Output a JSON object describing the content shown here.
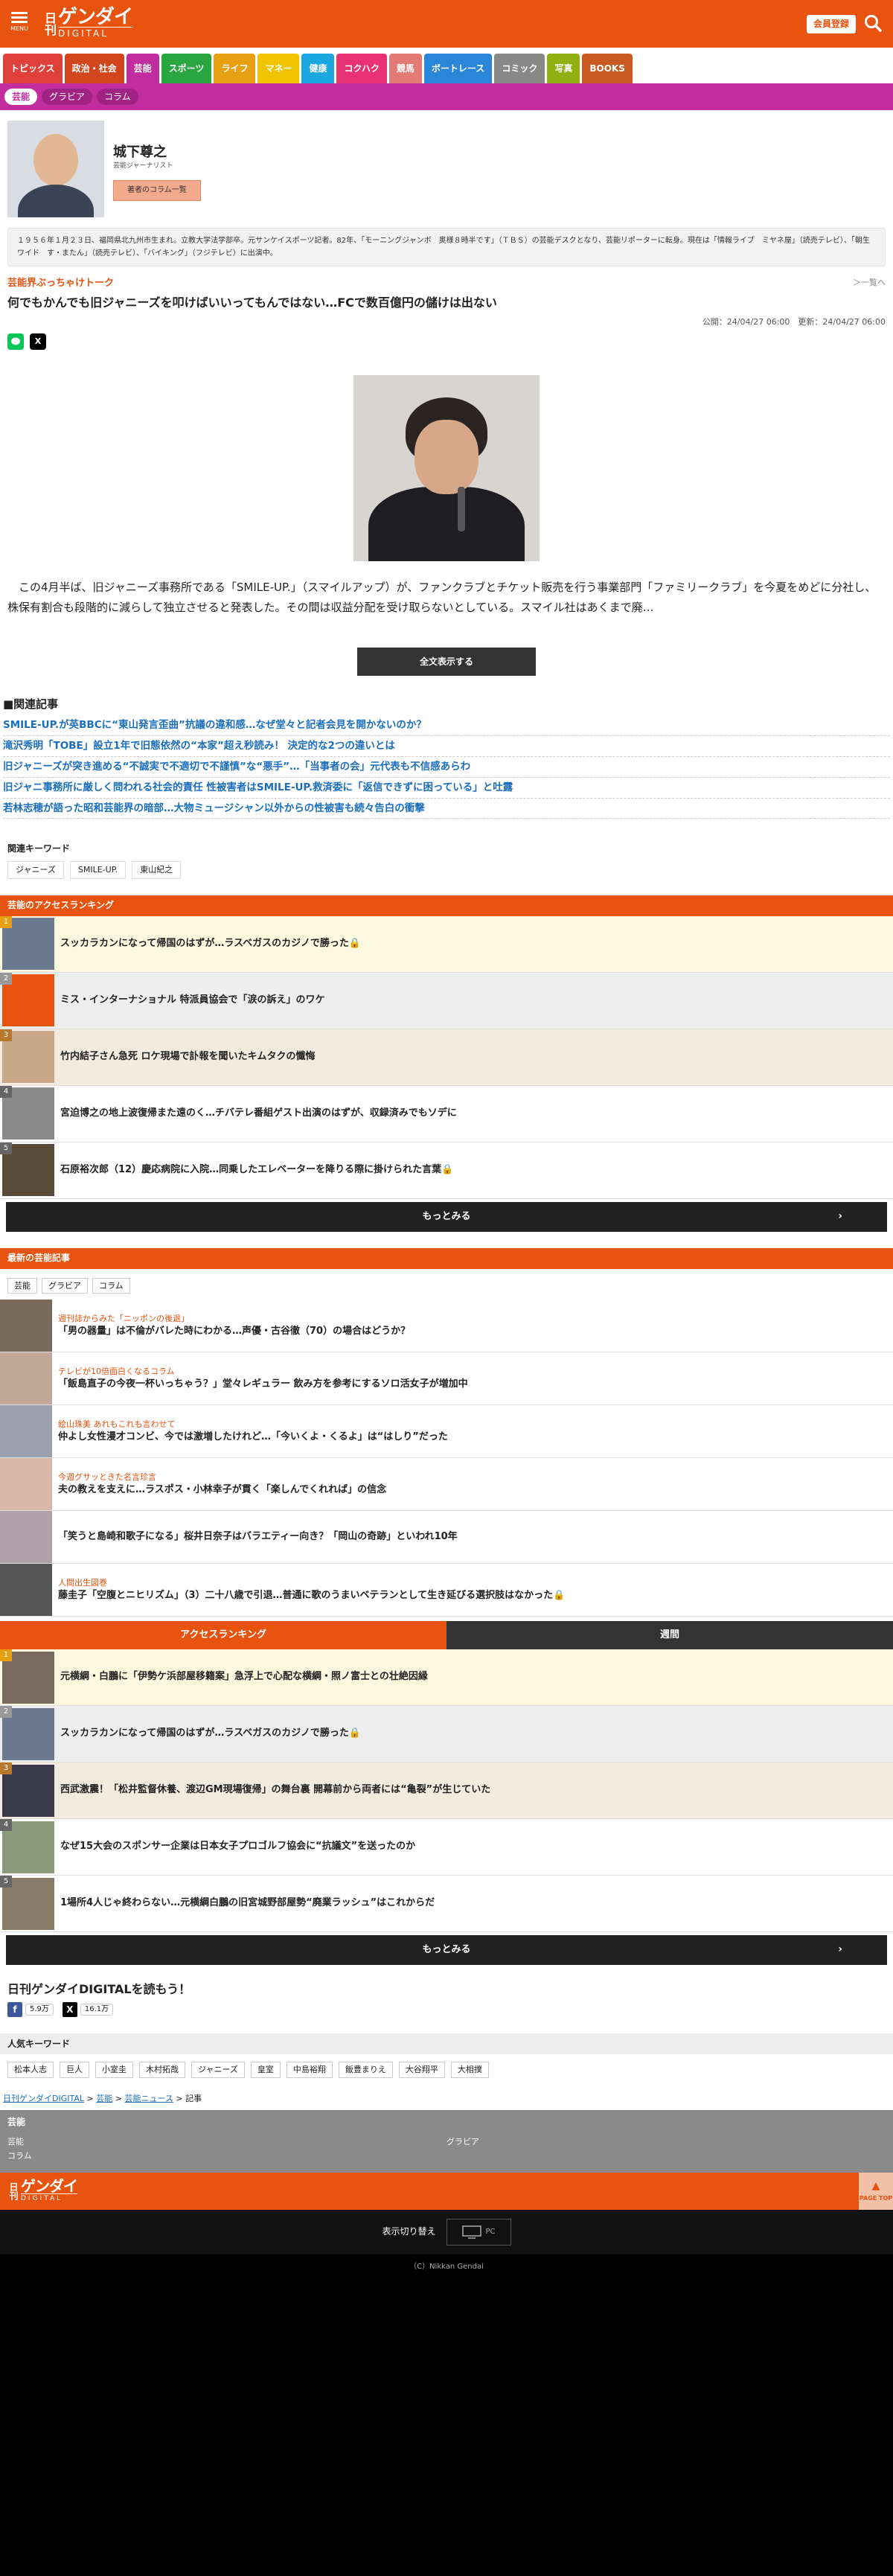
{
  "header": {
    "menu_label": "MENU",
    "logo_nikkan": "日刊",
    "logo_gendai": "ゲンダイ",
    "logo_digital": "DIGITAL",
    "member_label": "会員登録",
    "accent": "#e8530f"
  },
  "categories": [
    {
      "label": "トピックス",
      "color": "#e0403a"
    },
    {
      "label": "政治・社会",
      "color": "#d2461e"
    },
    {
      "label": "芸能",
      "color": "#c12d9e"
    },
    {
      "label": "スポーツ",
      "color": "#2aa640"
    },
    {
      "label": "ライフ",
      "color": "#e8a012"
    },
    {
      "label": "マネー",
      "color": "#f0c400"
    },
    {
      "label": "健康",
      "color": "#1ba8e0"
    },
    {
      "label": "コクハク",
      "color": "#e83272"
    },
    {
      "label": "競馬",
      "color": "#e37b74"
    },
    {
      "label": "ボートレース",
      "color": "#2a86d8"
    },
    {
      "label": "コミック",
      "color": "#888888"
    },
    {
      "label": "写真",
      "color": "#92b012"
    },
    {
      "label": "BOOKS",
      "color": "#c85a22"
    }
  ],
  "subnav": [
    "芸能",
    "グラビア",
    "コラム"
  ],
  "author": {
    "name": "城下尊之",
    "role": "芸能ジャーナリスト",
    "columns_button": "著者のコラム一覧",
    "bio": "１９５６年１月２３日、福岡県北九州市生まれ。立教大学法学部卒。元サンケイスポーツ記者。82年、「モーニングジャンボ　奥様８時半です」（ＴＢＳ）の芸能デスクとなり、芸能リポーターに転身。現在は「情報ライブ　ミヤネ屋」（読売テレビ）、「朝生ワイド　す・またん」（読売テレビ）、「バイキング」（フジテレビ）に出演中。"
  },
  "article": {
    "series": "芸能界ぶっちゃけトーク",
    "more": "＞一覧へ",
    "title": "何でもかんでも旧ジャニーズを叩けばいいってもんではない…FCで数百億円の儲けは出ない",
    "dates": "公開：24/04/27 06:00　更新：24/04/27 06:00",
    "lead": "この4月半ば、旧ジャニーズ事務所である「SMILE-UP.」（スマイルアップ）が、ファンクラブとチケット販売を行う事業部門「ファミリークラブ」を今夏をめどに分社し、株保有割合も段階的に減らして独立させると発表した。その間は収益分配を受け取らないとしている。スマイル社はあくまで廃…",
    "fulltext_button": "全文表示する",
    "share_line": "LINE",
    "share_x": "X"
  },
  "related": {
    "heading": "■関連記事",
    "items": [
      "SMILE-UP.が英BBCに“東山発言歪曲”抗議の違和感…なぜ堂々と記者会見を開かないのか？",
      "滝沢秀明「TOBE」設立1年で旧態依然の“本家”超え秒読み！ 決定的な2つの違いとは",
      "旧ジャニーズが突き進める“不誠実で不適切で不謹慎”な“悪手”…「当事者の会」元代表も不信感あらわ",
      "旧ジャニ事務所に厳しく問われる社会的責任 性被害者はSMILE-UP.救済委に「返信できずに困っている」と吐露",
      "若林志穂が語った昭和芸能界の暗部…大物ミュージシャン以外からの性被害も続々告白の衝撃"
    ]
  },
  "keywords": {
    "heading": "関連キーワード",
    "items": [
      "ジャニーズ",
      "SMILE-UP.",
      "東山紀之"
    ]
  },
  "ranking1": {
    "heading": "芸能のアクセスランキング",
    "items": [
      {
        "num": "1",
        "title": "スッカラカンになって帰国のはずが…ラスベガスのカジノで勝った🔒",
        "bg": "#fbf8e0",
        "thumb": "#6a7890"
      },
      {
        "num": "2",
        "title": "ミス・インターナショナル 特派員協会で「涙の訴え」のワケ",
        "bg": "#eeeeee",
        "thumb": "#e8530f"
      },
      {
        "num": "3",
        "title": "竹内結子さん急死 ロケ現場で訃報を聞いたキムタクの懺悔",
        "bg": "#f3ebe0",
        "thumb": "#c9a88a"
      },
      {
        "num": "4",
        "title": "宮迫博之の地上波復帰また遠のく…チバテレ番組ゲスト出演のはずが、収録済みでもソデに",
        "bg": "#ffffff",
        "thumb": "#8a8a8a"
      },
      {
        "num": "5",
        "title": "石原裕次郎（12）慶応病院に入院…同乗したエレベーターを降りる際に掛けられた言葉🔒",
        "bg": "#ffffff",
        "thumb": "#5a4a3a"
      }
    ],
    "more": "もっとみる"
  },
  "latest": {
    "heading": "最新の芸能記事",
    "tabs": [
      "芸能",
      "グラビア",
      "コラム"
    ],
    "items": [
      {
        "series": "週刊誌からみた「ニッポンの後退」",
        "title": "「男の器量」は不倫がバレた時にわかる…声優・古谷徹（70）の場合はどうか？",
        "thumb": "#7a6a5a"
      },
      {
        "series": "テレビが10倍面白くなるコラム",
        "title": "「飯島直子の今夜一杯いっちゃう？」堂々レギュラー 飲み方を参考にするソロ活女子が増加中",
        "thumb": "#c2a898"
      },
      {
        "series": "絵山珠美 あれもこれも言わせて",
        "title": "仲よし女性漫才コンビ、今では激増したけれど…「今いくよ・くるよ」は“はしり”だった",
        "thumb": "#9aa0b0"
      },
      {
        "series": "今週グサッときた名言珍言",
        "title": "夫の教えを支えに…ラスポス・小林幸子が貫く「楽しんでくれれば」の信念",
        "thumb": "#d8b8a8"
      },
      {
        "series": "",
        "title": "「笑うと島崎和歌子になる」桜井日奈子はバラエティー向き？「岡山の奇跡」といわれ10年",
        "thumb": "#b0a0a8"
      },
      {
        "series": "人間出生図巻",
        "title": "藤圭子「空腹とニヒリズム」（3）二十八歳で引退…普通に歌のうまいベテランとして生き延びる選択肢はなかった🔒",
        "thumb": "#555555"
      }
    ]
  },
  "ranking2": {
    "tab_access": "アクセスランキング",
    "tab_weekly": "週間",
    "items": [
      {
        "num": "1",
        "title": "元横綱・白鵬に「伊勢ケ浜部屋移籍案」急浮上で心配な横綱・照ノ富士との壮絶因縁",
        "bg": "#fbf8e0",
        "thumb": "#7a6a60"
      },
      {
        "num": "2",
        "title": "スッカラカンになって帰国のはずが…ラスベガスのカジノで勝った🔒",
        "bg": "#eeeeee",
        "thumb": "#6a7890"
      },
      {
        "num": "3",
        "title": "西武激震！「松井監督休養、渡辺GM現場復帰」の舞台裏 開幕前から両者には“亀裂”が生じていた",
        "bg": "#f3ebe0",
        "thumb": "#3a3a4a"
      },
      {
        "num": "4",
        "title": "なぜ15大会のスポンサー企業は日本女子プロゴルフ協会に“抗議文”を送ったのか",
        "bg": "#ffffff",
        "thumb": "#8a9a7a"
      },
      {
        "num": "5",
        "title": "1場所4人じゃ終わらない…元横綱白鵬の旧宮城野部屋勢“廃業ラッシュ”はこれからだ",
        "bg": "#ffffff",
        "thumb": "#8a7a6a"
      }
    ],
    "more": "もっとみる"
  },
  "follow": {
    "heading": "日刊ゲンダイDIGITALを読もう！",
    "fb_count": "5.9万",
    "x_count": "16.1万"
  },
  "popular": {
    "heading": "人気キーワード",
    "items": [
      "松本人志",
      "巨人",
      "小室圭",
      "木村拓哉",
      "ジャニーズ",
      "皇室",
      "中島裕翔",
      "飯豊まりえ",
      "大谷翔平",
      "大相撲"
    ]
  },
  "breadcrumb": {
    "home": "日刊ゲンダイDIGITAL",
    "sep": " > ",
    "cat": "芸能",
    "news": "芸能ニュース",
    "current": "記事"
  },
  "footnav": {
    "heading": "芸能",
    "items": [
      "芸能",
      "グラビア",
      "コラム"
    ]
  },
  "footer": {
    "pagetop": "PAGE TOP",
    "switch_label": "表示切り替え",
    "pc_label": "PC",
    "copyright": "（C）Nikkan Gendai"
  }
}
